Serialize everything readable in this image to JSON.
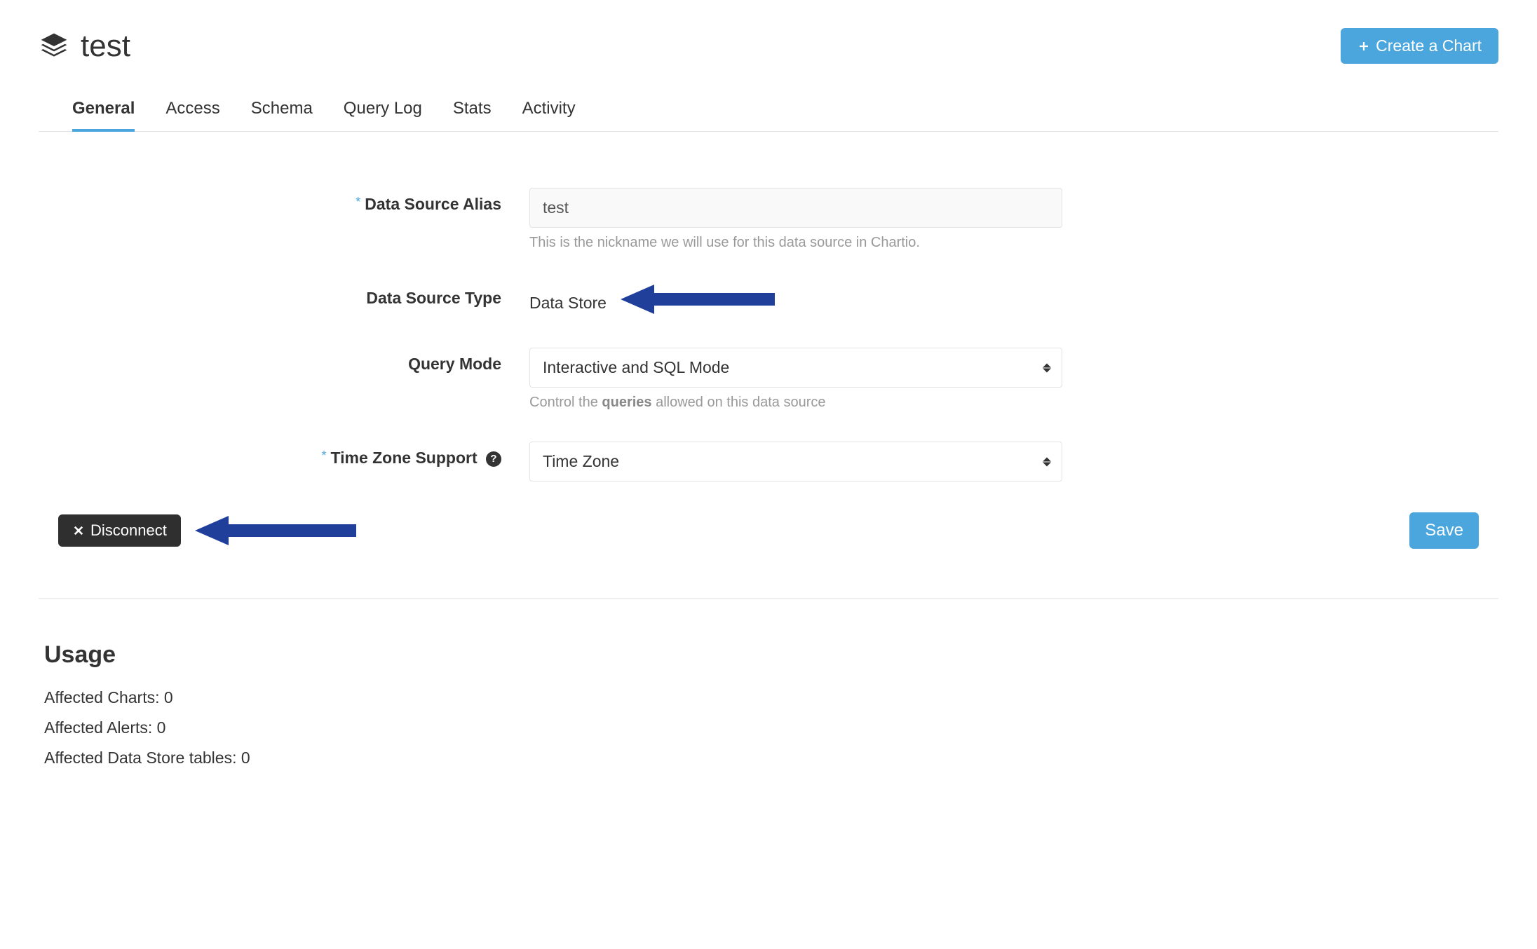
{
  "header": {
    "title": "test",
    "create_chart_label": "Create a Chart"
  },
  "tabs": [
    {
      "label": "General",
      "active": true
    },
    {
      "label": "Access",
      "active": false
    },
    {
      "label": "Schema",
      "active": false
    },
    {
      "label": "Query Log",
      "active": false
    },
    {
      "label": "Stats",
      "active": false
    },
    {
      "label": "Activity",
      "active": false
    }
  ],
  "form": {
    "alias": {
      "label": "Data Source Alias",
      "required": true,
      "value": "test",
      "helper": "This is the nickname we will use for this data source in Chartio."
    },
    "type": {
      "label": "Data Source Type",
      "value": "Data Store"
    },
    "query_mode": {
      "label": "Query Mode",
      "value": "Interactive and SQL Mode",
      "helper_prefix": "Control the ",
      "helper_bold": "queries",
      "helper_suffix": " allowed on this data source"
    },
    "timezone": {
      "label": "Time Zone Support",
      "required": true,
      "value": "Time Zone"
    }
  },
  "actions": {
    "disconnect_label": "Disconnect",
    "save_label": "Save"
  },
  "usage": {
    "title": "Usage",
    "charts_label": "Affected Charts: ",
    "charts_value": "0",
    "alerts_label": "Affected Alerts: ",
    "alerts_value": "0",
    "tables_label": "Affected Data Store tables: ",
    "tables_value": "0"
  },
  "colors": {
    "accent": "#4ba6dd",
    "arrow": "#1f3f9a"
  }
}
